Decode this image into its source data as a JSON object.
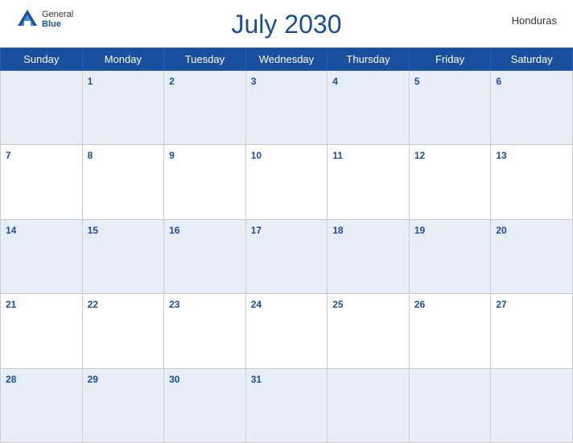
{
  "header": {
    "title": "July 2030",
    "country": "Honduras",
    "logo_general": "General",
    "logo_blue": "Blue"
  },
  "weekdays": [
    "Sunday",
    "Monday",
    "Tuesday",
    "Wednesday",
    "Thursday",
    "Friday",
    "Saturday"
  ],
  "weeks": [
    [
      null,
      1,
      2,
      3,
      4,
      5,
      6
    ],
    [
      7,
      8,
      9,
      10,
      11,
      12,
      13
    ],
    [
      14,
      15,
      16,
      17,
      18,
      19,
      20
    ],
    [
      21,
      22,
      23,
      24,
      25,
      26,
      27
    ],
    [
      28,
      29,
      30,
      31,
      null,
      null,
      null
    ]
  ]
}
